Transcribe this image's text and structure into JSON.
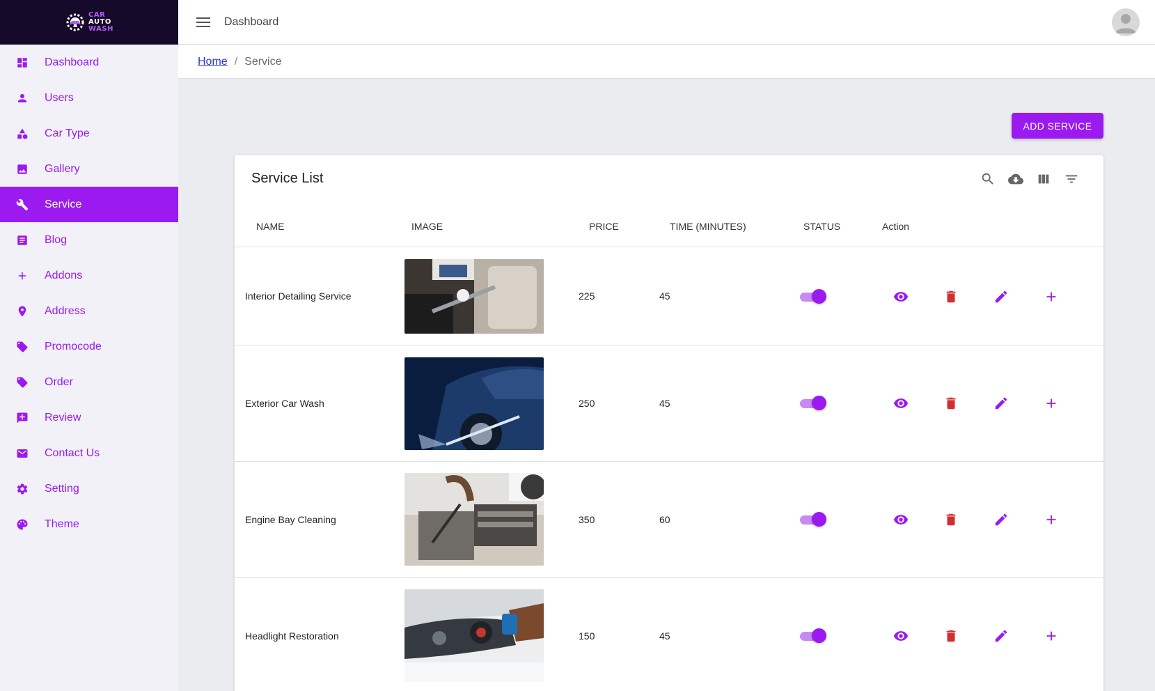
{
  "brand": {
    "line1": "CAR",
    "line2": "AUTO",
    "line3": "WASH"
  },
  "header": {
    "title": "Dashboard"
  },
  "breadcrumb": {
    "home": "Home",
    "separator": "/",
    "current": "Service"
  },
  "sidebar": {
    "items": [
      {
        "label": "Dashboard",
        "icon": "dashboard-icon"
      },
      {
        "label": "Users",
        "icon": "person-icon"
      },
      {
        "label": "Car Type",
        "icon": "category-icon"
      },
      {
        "label": "Gallery",
        "icon": "image-icon"
      },
      {
        "label": "Service",
        "icon": "wrench-icon",
        "active": true
      },
      {
        "label": "Blog",
        "icon": "article-icon"
      },
      {
        "label": "Addons",
        "icon": "plus-icon"
      },
      {
        "label": "Address",
        "icon": "location-pin-icon"
      },
      {
        "label": "Promocode",
        "icon": "tag-icon"
      },
      {
        "label": "Order",
        "icon": "tag-icon"
      },
      {
        "label": "Review",
        "icon": "rate-review-icon"
      },
      {
        "label": "Contact Us",
        "icon": "email-icon"
      },
      {
        "label": "Setting",
        "icon": "gear-icon"
      },
      {
        "label": "Theme",
        "icon": "palette-icon"
      }
    ]
  },
  "actions": {
    "add_service": "ADD SERVICE"
  },
  "table": {
    "title": "Service List",
    "toolbar_icons": [
      "search-icon",
      "download-icon",
      "view-columns-icon",
      "filter-icon"
    ],
    "columns": [
      "NAME",
      "IMAGE",
      "PRICE",
      "TIME (MINUTES)",
      "STATUS",
      "Action"
    ],
    "rows": [
      {
        "name": "Interior Detailing Service",
        "image": "interior-detailing-photo",
        "price": "225",
        "time": "45",
        "status": true
      },
      {
        "name": "Exterior Car Wash",
        "image": "exterior-wash-photo",
        "price": "250",
        "time": "45",
        "status": true
      },
      {
        "name": "Engine Bay Cleaning",
        "image": "engine-bay-photo",
        "price": "350",
        "time": "60",
        "status": true
      },
      {
        "name": "Headlight Restoration",
        "image": "headlight-photo",
        "price": "150",
        "time": "45",
        "status": true
      }
    ]
  },
  "colors": {
    "accent": "#9b1af0",
    "delete": "#d32f2f",
    "sidebar_bg": "#f2f1f8",
    "logo_bg": "#160a2a"
  }
}
